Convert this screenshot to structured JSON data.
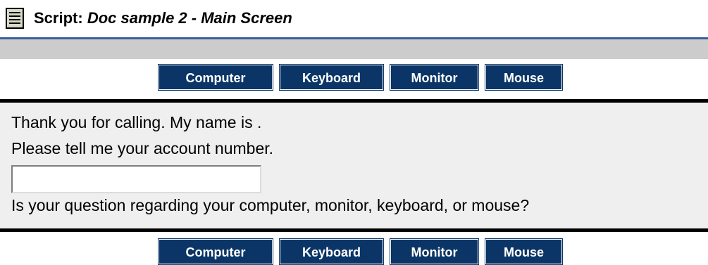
{
  "header": {
    "prefix": "Script:",
    "script_name": "Doc sample 2 - Main Screen",
    "icon": "script-document-icon"
  },
  "nav": {
    "items": [
      {
        "label": "Computer"
      },
      {
        "label": "Keyboard"
      },
      {
        "label": "Monitor"
      },
      {
        "label": "Mouse"
      }
    ]
  },
  "content": {
    "greeting": "Thank you for calling. My name is .",
    "account_prompt": "Please tell me your account number.",
    "account_value": "",
    "question": "Is your question regarding your computer, monitor, keyboard, or mouse?"
  },
  "colors": {
    "nav_button_bg": "#0b3566",
    "title_rule": "#3a5f9f",
    "gray_band": "#cccccc",
    "panel_bg": "#efefef"
  }
}
